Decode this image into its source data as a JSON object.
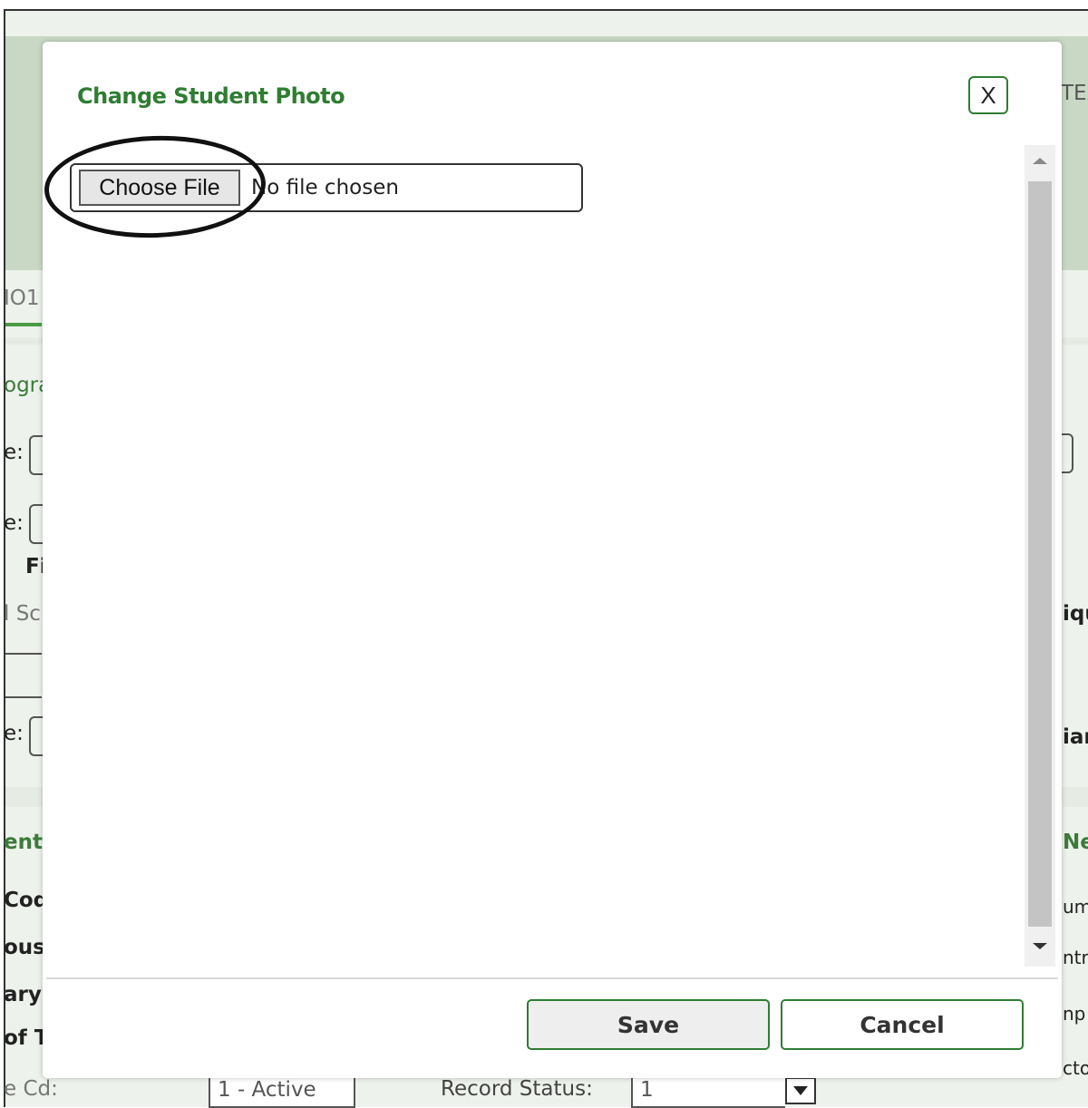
{
  "dialog": {
    "title": "Change Student Photo",
    "close_label": "X",
    "file_input": {
      "button_label": "Choose File",
      "status": "No file chosen"
    },
    "save_label": "Save",
    "cancel_label": "Cancel"
  },
  "background": {
    "fragments": [
      {
        "id": "tex",
        "text": "TEX"
      },
      {
        "id": "tab",
        "text": "IO1"
      },
      {
        "id": "ogra",
        "text": "ogra"
      },
      {
        "id": "e1",
        "text": "e:"
      },
      {
        "id": "e2",
        "text": "e:"
      },
      {
        "id": "fi",
        "text": "Fi"
      },
      {
        "id": "lsc",
        "text": "l Sc"
      },
      {
        "id": "e3",
        "text": "e:"
      },
      {
        "id": "iqu",
        "text": "iqu"
      },
      {
        "id": "ian",
        "text": "ian"
      },
      {
        "id": "ent",
        "text": "ent"
      },
      {
        "id": "cod",
        "text": "Cod"
      },
      {
        "id": "ous",
        "text": "ous"
      },
      {
        "id": "ary",
        "text": "ary"
      },
      {
        "id": "oft",
        "text": "of T"
      },
      {
        "id": "nex",
        "text": "Nex"
      },
      {
        "id": "um",
        "text": "um"
      },
      {
        "id": "ntrl",
        "text": "ntrl"
      },
      {
        "id": "np",
        "text": "np"
      },
      {
        "id": "ct",
        "text": "cto"
      }
    ],
    "status_cd_label": "e Cd:",
    "status_cd_value": "1 - Active",
    "record_status_label": "Record Status:",
    "record_status_value": "1"
  }
}
